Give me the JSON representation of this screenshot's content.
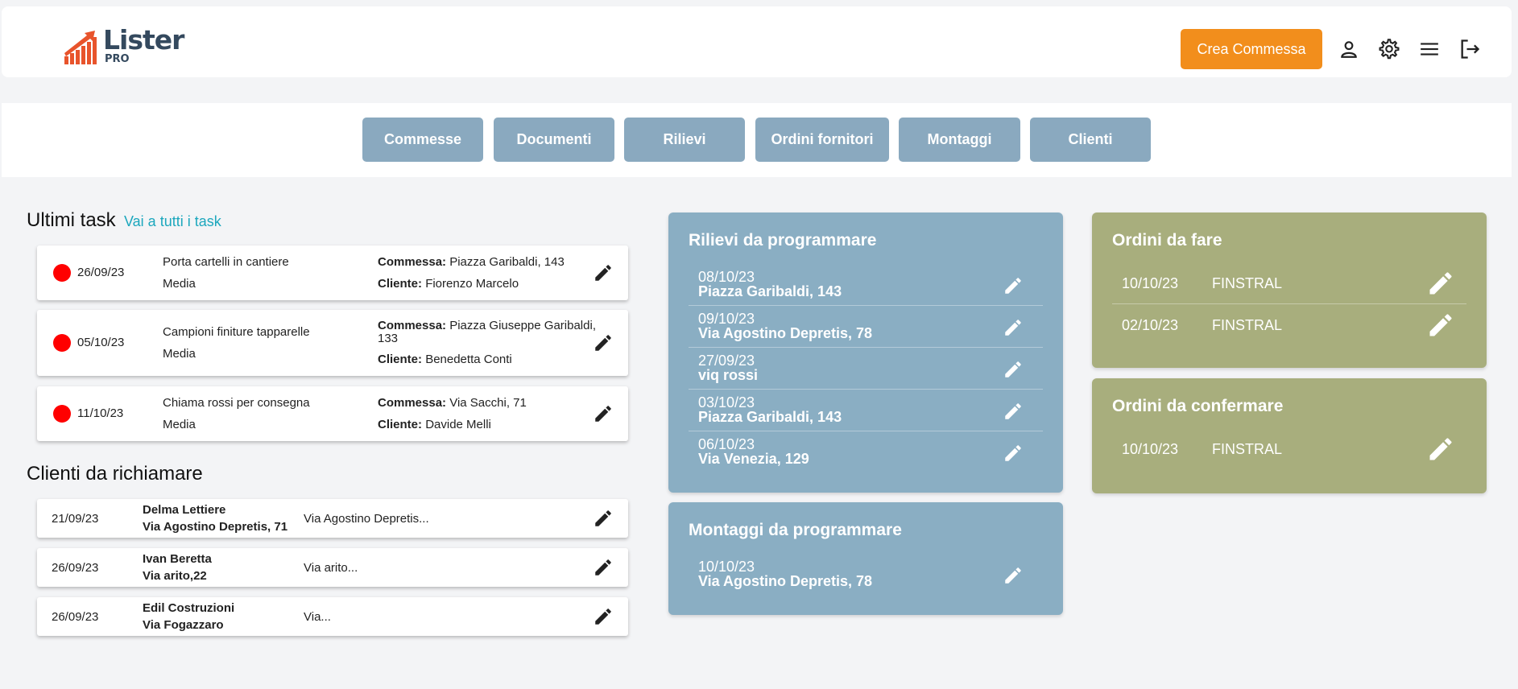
{
  "header": {
    "logo_text": "Lister",
    "logo_sub": "PRO",
    "create_button": "Crea Commessa",
    "icons": [
      "user-icon",
      "settings-icon",
      "menu-icon",
      "logout-icon"
    ]
  },
  "nav": {
    "tabs": [
      "Commesse",
      "Documenti",
      "Rilievi",
      "Ordini fornitori",
      "Montaggi",
      "Clienti"
    ]
  },
  "tasks": {
    "title": "Ultimi task",
    "link": "Vai a tutti i task",
    "commessa_label": "Commessa:",
    "cliente_label": "Cliente:",
    "items": [
      {
        "date": "26/09/23",
        "name": "Porta cartelli in cantiere",
        "priority": "Media",
        "commessa": "Piazza Garibaldi, 143",
        "commessa2": "",
        "cliente": "Fiorenzo  Marcelo"
      },
      {
        "date": "05/10/23",
        "name": "Campioni finiture tapparelle",
        "priority": "Media",
        "commessa": "Piazza Giuseppe Garibaldi,",
        "commessa2": "133",
        "cliente": "Benedetta  Conti"
      },
      {
        "date": "11/10/23",
        "name": "Chiama rossi per consegna",
        "priority": "Media",
        "commessa": "Via Sacchi, 71",
        "commessa2": "",
        "cliente": "Davide Melli"
      }
    ]
  },
  "clients_callback": {
    "title": "Clienti da richiamare",
    "items": [
      {
        "date": "21/09/23",
        "name": "Delma  Lettiere",
        "address": "Via Agostino Depretis, 71",
        "note": "Via Agostino Depretis..."
      },
      {
        "date": "26/09/23",
        "name": "Ivan Beretta",
        "address": "Via arito,22",
        "note": "Via arito..."
      },
      {
        "date": "26/09/23",
        "name": "Edil Costruzioni",
        "address": "Via Fogazzaro",
        "note": "Via..."
      }
    ]
  },
  "rilievi": {
    "title": "Rilievi da programmare",
    "items": [
      {
        "date": "08/10/23",
        "address": "Piazza Garibaldi, 143"
      },
      {
        "date": "09/10/23",
        "address": "Via Agostino Depretis, 78"
      },
      {
        "date": "27/09/23",
        "address": "viq rossi"
      },
      {
        "date": "03/10/23",
        "address": "Piazza Garibaldi, 143"
      },
      {
        "date": "06/10/23",
        "address": "Via Venezia, 129"
      }
    ]
  },
  "montaggi": {
    "title": "Montaggi da programmare",
    "items": [
      {
        "date": "10/10/23",
        "address": "Via Agostino Depretis, 78"
      }
    ]
  },
  "ordini_fare": {
    "title": "Ordini da fare",
    "items": [
      {
        "date": "10/10/23",
        "supplier": "FINSTRAL"
      },
      {
        "date": "02/10/23",
        "supplier": "FINSTRAL"
      }
    ]
  },
  "ordini_confermare": {
    "title": "Ordini da confermare",
    "items": [
      {
        "date": "10/10/23",
        "supplier": "FINSTRAL"
      }
    ]
  },
  "colors": {
    "accent": "#f28e1c",
    "nav_button": "#8aa9bf",
    "panel_blue": "#8aaec3",
    "panel_olive": "#a8ae7d",
    "link": "#1ca7bd",
    "priority_dot": "#ff0000"
  }
}
